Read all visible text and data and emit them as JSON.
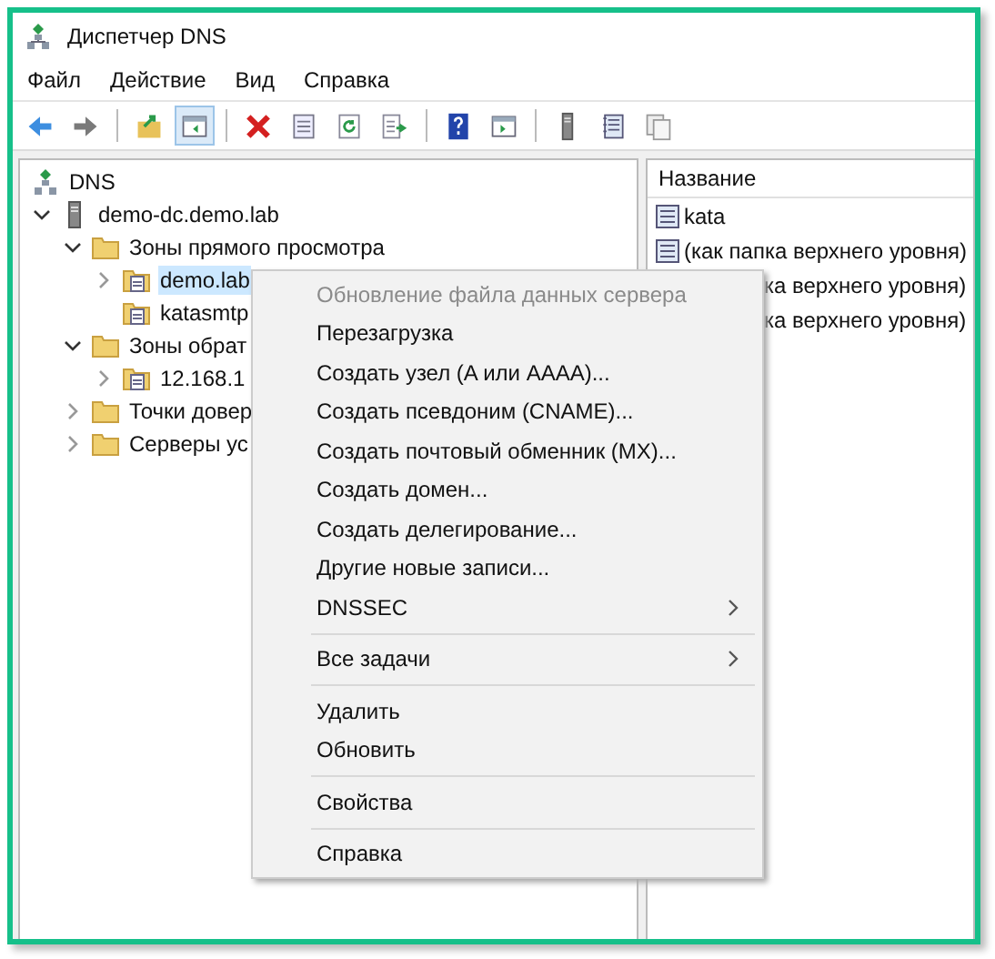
{
  "window": {
    "title": "Диспетчер DNS"
  },
  "menu_bar": [
    {
      "label": "Файл"
    },
    {
      "label": "Действие"
    },
    {
      "label": "Вид"
    },
    {
      "label": "Справка"
    }
  ],
  "toolbar": {
    "tree_toggle_pressed": true
  },
  "tree": [
    {
      "label": "DNS",
      "kind": "root",
      "selected": false,
      "children": [
        {
          "label": "demo-dc.demo.lab",
          "kind": "server",
          "expanded": true,
          "selected": false,
          "children": [
            {
              "label": "Зоны прямого просмотра",
              "kind": "folder",
              "expanded": true,
              "selected": false,
              "children": [
                {
                  "label": "demo.lab",
                  "kind": "zone",
                  "expanded": false,
                  "selected": true
                },
                {
                  "label": "katasmtp",
                  "kind": "zone",
                  "selected": false
                }
              ]
            },
            {
              "label": "Зоны обрат",
              "kind": "folder",
              "expanded": true,
              "selected": false,
              "children": [
                {
                  "label": "12.168.1",
                  "kind": "zone",
                  "expanded": false,
                  "selected": false
                }
              ]
            },
            {
              "label": "Точки довер",
              "kind": "folder",
              "expanded": false,
              "selected": false
            },
            {
              "label": "Серверы ус",
              "kind": "folder",
              "expanded": false,
              "selected": false
            }
          ]
        }
      ]
    }
  ],
  "details": {
    "column": "Название",
    "rows": [
      {
        "label": "kata"
      },
      {
        "label": "(как папка верхнего уровня)"
      },
      {
        "label": "ка верхнего уровня)"
      },
      {
        "label": "ка верхнего уровня)"
      }
    ]
  },
  "context_menu": [
    {
      "kind": "item",
      "label": "Обновление файла данных сервера",
      "disabled": true,
      "submenu": false
    },
    {
      "kind": "item",
      "label": "Перезагрузка",
      "disabled": false,
      "submenu": false
    },
    {
      "kind": "item",
      "label": "Создать узел (A или AAAA)...",
      "disabled": false,
      "submenu": false
    },
    {
      "kind": "item",
      "label": "Создать псевдоним (CNAME)...",
      "disabled": false,
      "submenu": false
    },
    {
      "kind": "item",
      "label": "Создать почтовый обменник (MX)...",
      "disabled": false,
      "submenu": false
    },
    {
      "kind": "item",
      "label": "Создать домен...",
      "disabled": false,
      "submenu": false
    },
    {
      "kind": "item",
      "label": "Создать делегирование...",
      "disabled": false,
      "submenu": false
    },
    {
      "kind": "item",
      "label": "Другие новые записи...",
      "disabled": false,
      "submenu": false
    },
    {
      "kind": "item",
      "label": "DNSSEC",
      "disabled": false,
      "submenu": true
    },
    {
      "kind": "separator"
    },
    {
      "kind": "item",
      "label": "Все задачи",
      "disabled": false,
      "submenu": true
    },
    {
      "kind": "separator"
    },
    {
      "kind": "item",
      "label": "Удалить",
      "disabled": false,
      "submenu": false
    },
    {
      "kind": "item",
      "label": "Обновить",
      "disabled": false,
      "submenu": false
    },
    {
      "kind": "separator"
    },
    {
      "kind": "item",
      "label": "Свойства",
      "disabled": false,
      "submenu": false
    },
    {
      "kind": "separator"
    },
    {
      "kind": "item",
      "label": "Справка",
      "disabled": false,
      "submenu": false
    }
  ]
}
